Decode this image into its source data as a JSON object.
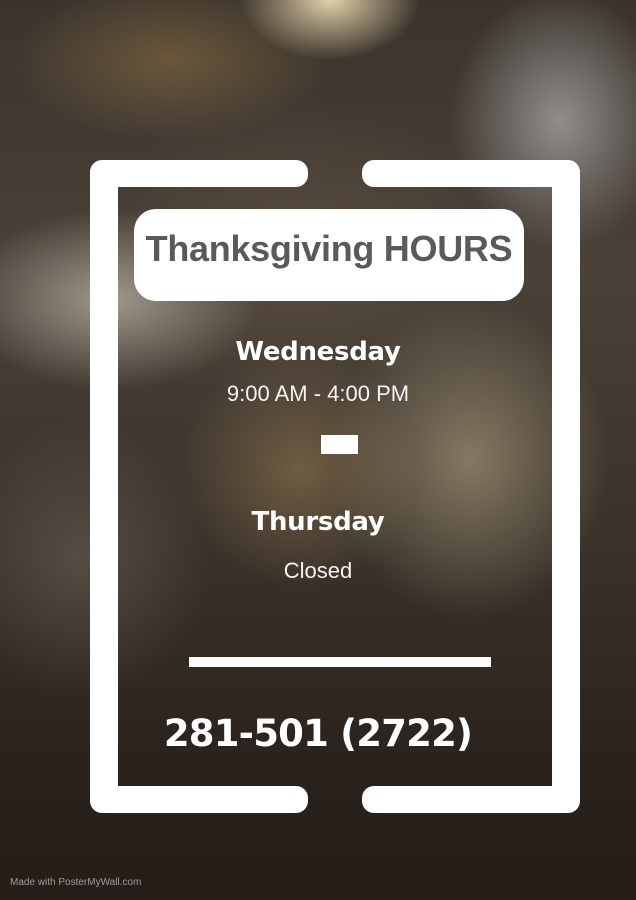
{
  "title": "Thanksgiving HOURS",
  "schedule": [
    {
      "day": "Wednesday",
      "hours": "9:00 AM - 4:00 PM"
    },
    {
      "day": "Thursday",
      "hours": "Closed"
    }
  ],
  "phone": "281-501 (2722)",
  "watermark": "Made with PosterMyWall.com",
  "colors": {
    "frame": "#ffffff",
    "title_text": "#5a5a5a",
    "body_text": "#ffffff"
  }
}
